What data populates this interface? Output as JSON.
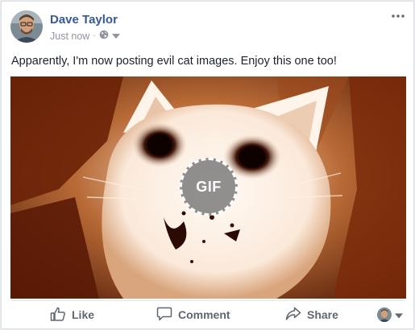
{
  "post": {
    "author": "Dave Taylor",
    "timestamp": "Just now",
    "separator": "·",
    "audience_icon": "globe-icon",
    "text": "Apparently, I'm now posting evil cat images. Enjoy this one too!",
    "media": {
      "type": "gif",
      "badge": "GIF",
      "tint_color": "#7a2b08"
    }
  },
  "actions": {
    "like": {
      "label": "Like",
      "icon": "thumbs-up-icon"
    },
    "comment": {
      "label": "Comment",
      "icon": "speech-bubble-icon"
    },
    "share": {
      "label": "Share",
      "icon": "share-arrow-icon"
    },
    "audience_selector": {
      "icon": "chevron-down-icon"
    }
  },
  "colors": {
    "author_link": "#365899",
    "meta_text": "#90949c",
    "action_text": "#606770"
  }
}
